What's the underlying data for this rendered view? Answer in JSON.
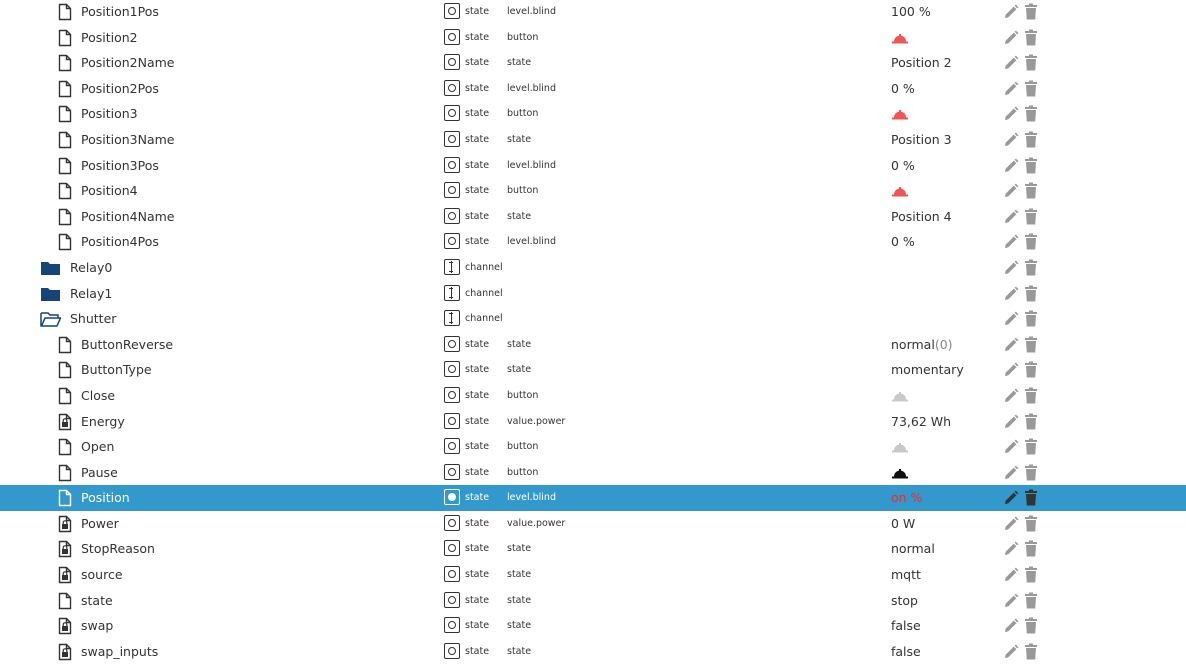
{
  "rows": [
    {
      "kind": "file",
      "name": "Position1Pos",
      "type": "state",
      "role": "level.blind",
      "value": "100 %",
      "vkind": "text"
    },
    {
      "kind": "file",
      "name": "Position2",
      "type": "state",
      "role": "button",
      "vkind": "bell",
      "bell_color": "#f05555"
    },
    {
      "kind": "file",
      "name": "Position2Name",
      "type": "state",
      "role": "state",
      "value": "Position 2",
      "vkind": "text"
    },
    {
      "kind": "file",
      "name": "Position2Pos",
      "type": "state",
      "role": "level.blind",
      "value": "0 %",
      "vkind": "text"
    },
    {
      "kind": "file",
      "name": "Position3",
      "type": "state",
      "role": "button",
      "vkind": "bell",
      "bell_color": "#f05555"
    },
    {
      "kind": "file",
      "name": "Position3Name",
      "type": "state",
      "role": "state",
      "value": "Position 3",
      "vkind": "text"
    },
    {
      "kind": "file",
      "name": "Position3Pos",
      "type": "state",
      "role": "level.blind",
      "value": "0 %",
      "vkind": "text"
    },
    {
      "kind": "file",
      "name": "Position4",
      "type": "state",
      "role": "button",
      "vkind": "bell",
      "bell_color": "#f05555"
    },
    {
      "kind": "file",
      "name": "Position4Name",
      "type": "state",
      "role": "state",
      "value": "Position 4",
      "vkind": "text"
    },
    {
      "kind": "file",
      "name": "Position4Pos",
      "type": "state",
      "role": "level.blind",
      "value": "0 %",
      "vkind": "text"
    },
    {
      "kind": "folder",
      "name": "Relay0",
      "type": "channel"
    },
    {
      "kind": "folder",
      "name": "Relay1",
      "type": "channel"
    },
    {
      "kind": "folder-open",
      "name": "Shutter",
      "type": "channel"
    },
    {
      "kind": "file",
      "name": "ButtonReverse",
      "type": "state",
      "role": "state",
      "value": "normal",
      "value_suffix": "(0)",
      "vkind": "text"
    },
    {
      "kind": "file",
      "name": "ButtonType",
      "type": "state",
      "role": "state",
      "value": "momentary",
      "vkind": "text"
    },
    {
      "kind": "file",
      "name": "Close",
      "type": "state",
      "role": "button",
      "vkind": "bell",
      "bell_color": "#c8c8c8"
    },
    {
      "kind": "lock",
      "name": "Energy",
      "type": "state",
      "role": "value.power",
      "value": "73,62 Wh",
      "vkind": "text"
    },
    {
      "kind": "file",
      "name": "Open",
      "type": "state",
      "role": "button",
      "vkind": "bell",
      "bell_color": "#c8c8c8"
    },
    {
      "kind": "file",
      "name": "Pause",
      "type": "state",
      "role": "button",
      "vkind": "bell",
      "bell_color": "#111111"
    },
    {
      "kind": "file",
      "name": "Position",
      "type": "state",
      "role": "level.blind",
      "value": "on %",
      "vkind": "text",
      "value_color": "red",
      "selected": true
    },
    {
      "kind": "lock",
      "name": "Power",
      "type": "state",
      "role": "value.power",
      "value": "0 W",
      "vkind": "text"
    },
    {
      "kind": "lock",
      "name": "StopReason",
      "type": "state",
      "role": "state",
      "value": "normal",
      "vkind": "text"
    },
    {
      "kind": "lock",
      "name": "source",
      "type": "state",
      "role": "state",
      "value": "mqtt",
      "vkind": "text"
    },
    {
      "kind": "file",
      "name": "state",
      "type": "state",
      "role": "state",
      "value": "stop",
      "vkind": "text"
    },
    {
      "kind": "lock",
      "name": "swap",
      "type": "state",
      "role": "state",
      "value": "false",
      "vkind": "text"
    },
    {
      "kind": "lock",
      "name": "swap_inputs",
      "type": "state",
      "role": "state",
      "value": "false",
      "vkind": "text"
    }
  ],
  "colors": {
    "selection": "#3399cc",
    "folder": "#164477",
    "action_icon": "#999999"
  },
  "icons": {
    "file": "file-icon",
    "lock": "locked-file-icon",
    "folder": "folder-icon",
    "folder-open": "folder-open-icon",
    "edit": "pencil-icon",
    "delete": "trash-icon",
    "state": "state-type-icon",
    "channel": "channel-type-icon",
    "bell": "bell-icon"
  }
}
